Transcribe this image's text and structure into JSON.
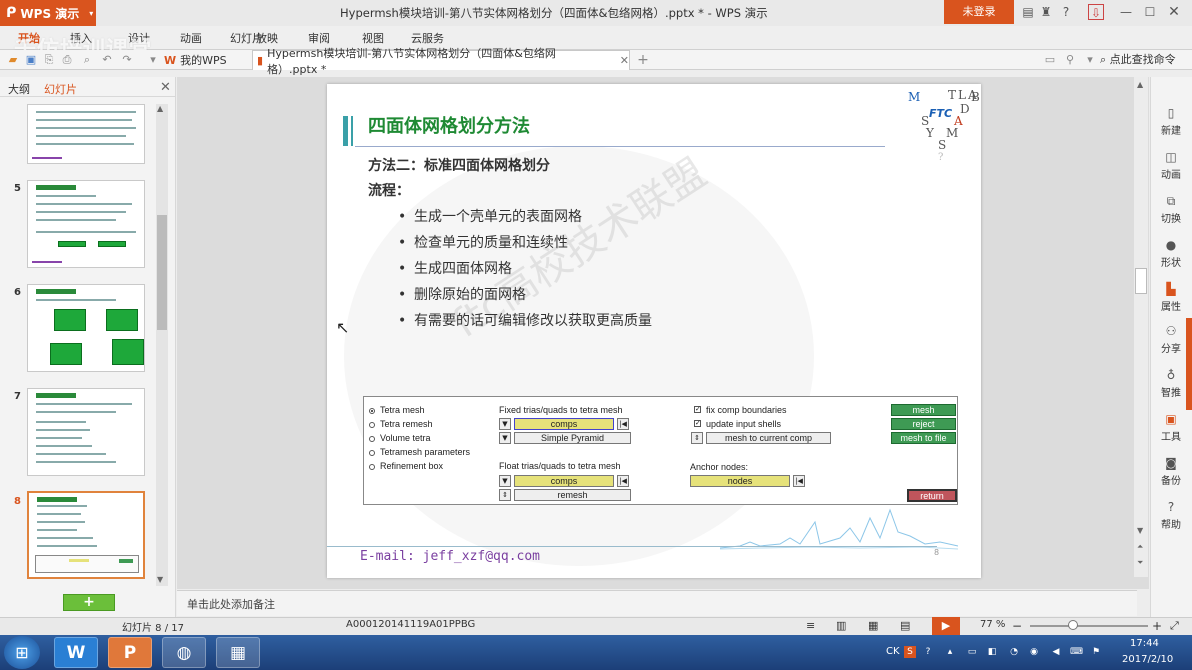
{
  "app": {
    "logo_label": "WPS 演示",
    "doc_title": "Hypermsh模块培训-第八节实体网格划分（四面体&包络网格）.pptx * - WPS 演示",
    "login_label": "未登录",
    "watermark_top": "千仿培训课堂"
  },
  "menu": [
    "开始",
    "插入",
    "设计",
    "动画",
    "幻灯片",
    "放映",
    "审阅",
    "视图",
    "云服务"
  ],
  "quickbar": {
    "tab_mywps": "我的WPS",
    "tab_doc": "Hypermsh模块培训-第八节实体网格划分（四面体&包络网格）.pptx *",
    "search": "点此查找命令"
  },
  "left_panel": {
    "tab_outline": "大纲",
    "tab_slides": "幻灯片",
    "thumb_numbers": [
      "5",
      "6",
      "7",
      "8"
    ],
    "add_label": "+"
  },
  "slide": {
    "title": "四面体网格划分方法",
    "method": "方法二：标准四面体网格划分",
    "flow": "流程：",
    "bullets": [
      "生成一个壳单元的表面网格",
      "检查单元的质量和连续性",
      "生成四面体网格",
      "删除原始的面网格",
      "有需要的话可编辑修改以获取更高质量"
    ],
    "watermark": "ftc高校技术联盟",
    "email": "E-mail: jeff_xzf@qq.com",
    "number": "8",
    "logo": {
      "letters": [
        "M",
        "T",
        "L",
        "A",
        "B",
        "D",
        "S",
        "Y",
        "A",
        "M",
        "S",
        "?"
      ],
      "ftc": "FTC"
    },
    "hypermesh": {
      "radios": [
        "Tetra mesh",
        "Tetra remesh",
        "Volume tetra",
        "Tetramesh parameters",
        "Refinement box"
      ],
      "fixed_label": "Fixed trias/quads to tetra mesh",
      "fixed_comps": "comps",
      "fixed_option": "Simple Pyramid",
      "float_label": "Float trias/quads to tetra mesh",
      "float_comps": "comps",
      "float_option": "remesh",
      "check_fix": "fix comp boundaries",
      "check_update": "update input shells",
      "mesh_to": "mesh to current comp",
      "anchor_label": "Anchor nodes:",
      "anchor_nodes": "nodes",
      "btn_mesh": "mesh",
      "btn_reject": "reject",
      "btn_mesh_file": "mesh to file",
      "btn_return": "return"
    }
  },
  "right_bar": [
    "新建",
    "动画",
    "切换",
    "形状",
    "属性",
    "分享",
    "智推",
    "工具",
    "备份",
    "帮助"
  ],
  "notes": {
    "placeholder": "单击此处添加备注"
  },
  "status": {
    "slide_counter": "幻灯片 8 / 17",
    "code": "A000120141119A01PPBG",
    "zoom": "77 %"
  },
  "taskbar": {
    "time": "17:44",
    "date": "2017/2/10",
    "lang": "CK"
  }
}
